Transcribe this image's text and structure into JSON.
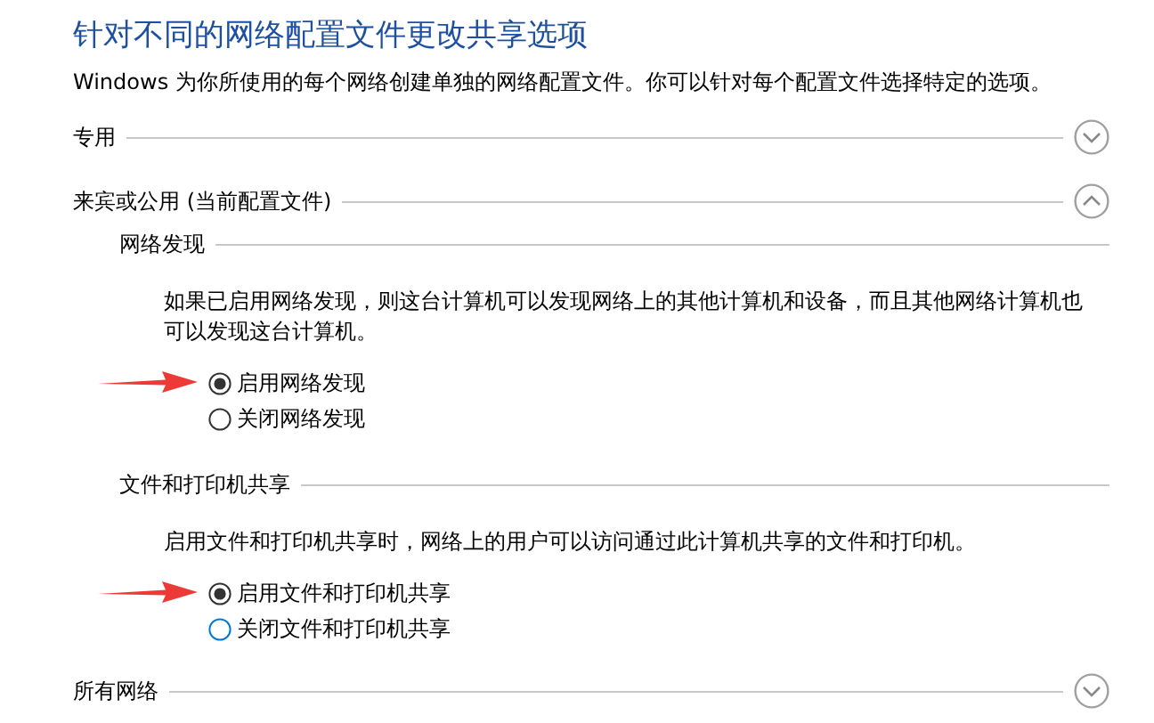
{
  "title": "针对不同的网络配置文件更改共享选项",
  "description": "Windows 为你所使用的每个网络创建单独的网络配置文件。你可以针对每个配置文件选择特定的选项。",
  "profiles": [
    {
      "label": "专用",
      "expanded": false
    },
    {
      "label": "来宾或公用 (当前配置文件)",
      "expanded": true,
      "settings": [
        {
          "heading": "网络发现",
          "text": "如果已启用网络发现，则这台计算机可以发现网络上的其他计算机和设备，而且其他网络计算机也可以发现这台计算机。",
          "options": [
            {
              "label": "启用网络发现",
              "selected": true,
              "annotated": true,
              "hovered": false
            },
            {
              "label": "关闭网络发现",
              "selected": false,
              "annotated": false,
              "hovered": false
            }
          ]
        },
        {
          "heading": "文件和打印机共享",
          "text": "启用文件和打印机共享时，网络上的用户可以访问通过此计算机共享的文件和打印机。",
          "options": [
            {
              "label": "启用文件和打印机共享",
              "selected": true,
              "annotated": true,
              "hovered": false
            },
            {
              "label": "关闭文件和打印机共享",
              "selected": false,
              "annotated": false,
              "hovered": true
            }
          ]
        }
      ]
    },
    {
      "label": "所有网络",
      "expanded": false
    }
  ]
}
